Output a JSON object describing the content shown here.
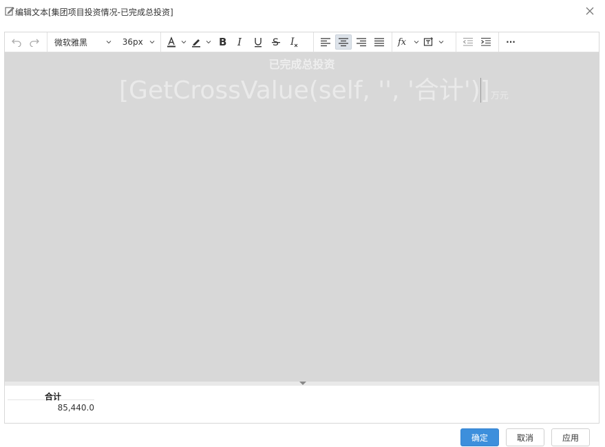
{
  "dialog": {
    "title": "编辑文本[集团项目投资情况-已完成总投资]"
  },
  "toolbar": {
    "font_family": "微软雅黑",
    "font_size": "36px",
    "more_label": "···"
  },
  "canvas": {
    "heading": "已完成总投资",
    "formula": "[GetCrossValue(self, '', '合计')]",
    "unit": "万元",
    "background_color": "#d8d8d8"
  },
  "preview": {
    "header": "合计",
    "value": "85,440.0"
  },
  "buttons": {
    "confirm": "确定",
    "cancel": "取消",
    "apply": "应用"
  },
  "colors": {
    "primary": "#3d8fdc"
  }
}
